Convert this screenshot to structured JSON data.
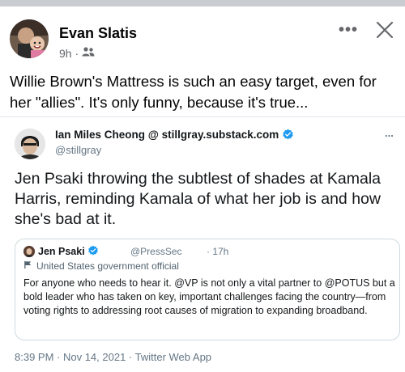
{
  "post": {
    "author": "Evan Slatis",
    "time": "9h ·",
    "audience_icon": "friends-icon",
    "text": "Willie Brown's Mattress is such an easy target, even for her \"allies\".  It's only funny, because it's true..."
  },
  "tweet": {
    "display_name": "Ian Miles Cheong @ stillgray.substack.com",
    "handle": "@stillgray",
    "more": "...",
    "text": "Jen Psaki throwing the subtlest of shades at Kamala Harris, reminding Kamala of what her job is and how she's bad at it.",
    "timestamp": "8:39 PM · Nov 14, 2021 · Twitter Web App"
  },
  "quoted": {
    "display_name": "Jen Psaki",
    "handle": "@PressSec",
    "time": "· 17h",
    "label": "United States government official",
    "text": "For anyone who needs to hear it. @VP is not only a vital partner to @POTUS but a bold leader who has taken on key, important challenges facing the country—from voting rights to addressing root causes of migration to expanding broadband."
  },
  "colors": {
    "verified": "#1d9bf0",
    "secondary_text": "#65676b",
    "twitter_gray": "#657786"
  }
}
